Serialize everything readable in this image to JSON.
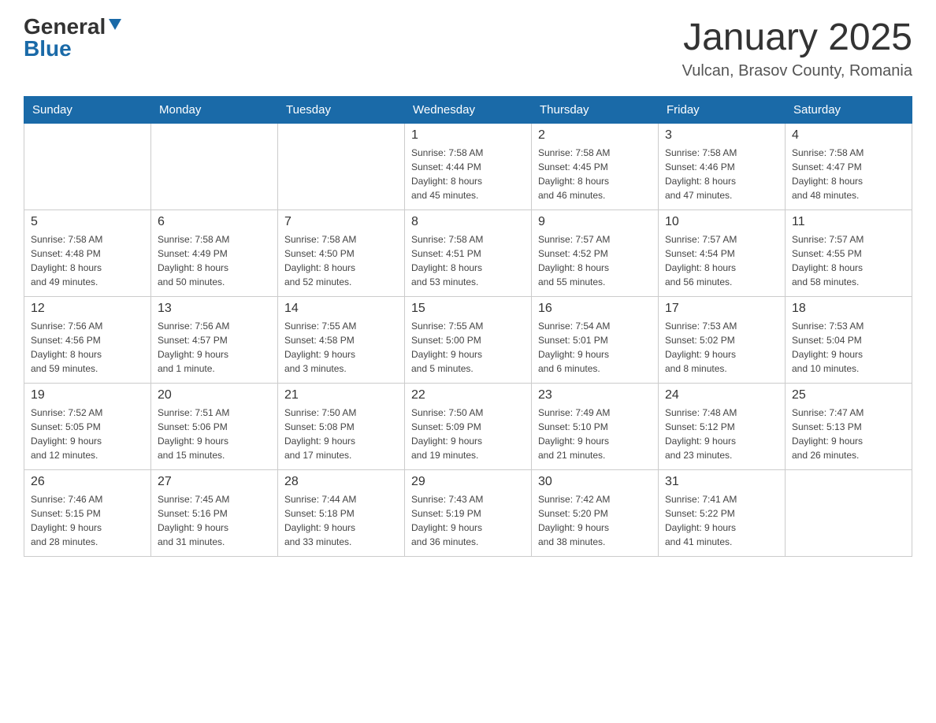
{
  "header": {
    "logo_general": "General",
    "logo_blue": "Blue",
    "month_title": "January 2025",
    "location": "Vulcan, Brasov County, Romania"
  },
  "days_of_week": [
    "Sunday",
    "Monday",
    "Tuesday",
    "Wednesday",
    "Thursday",
    "Friday",
    "Saturday"
  ],
  "weeks": [
    [
      {
        "day": "",
        "info": ""
      },
      {
        "day": "",
        "info": ""
      },
      {
        "day": "",
        "info": ""
      },
      {
        "day": "1",
        "info": "Sunrise: 7:58 AM\nSunset: 4:44 PM\nDaylight: 8 hours\nand 45 minutes."
      },
      {
        "day": "2",
        "info": "Sunrise: 7:58 AM\nSunset: 4:45 PM\nDaylight: 8 hours\nand 46 minutes."
      },
      {
        "day": "3",
        "info": "Sunrise: 7:58 AM\nSunset: 4:46 PM\nDaylight: 8 hours\nand 47 minutes."
      },
      {
        "day": "4",
        "info": "Sunrise: 7:58 AM\nSunset: 4:47 PM\nDaylight: 8 hours\nand 48 minutes."
      }
    ],
    [
      {
        "day": "5",
        "info": "Sunrise: 7:58 AM\nSunset: 4:48 PM\nDaylight: 8 hours\nand 49 minutes."
      },
      {
        "day": "6",
        "info": "Sunrise: 7:58 AM\nSunset: 4:49 PM\nDaylight: 8 hours\nand 50 minutes."
      },
      {
        "day": "7",
        "info": "Sunrise: 7:58 AM\nSunset: 4:50 PM\nDaylight: 8 hours\nand 52 minutes."
      },
      {
        "day": "8",
        "info": "Sunrise: 7:58 AM\nSunset: 4:51 PM\nDaylight: 8 hours\nand 53 minutes."
      },
      {
        "day": "9",
        "info": "Sunrise: 7:57 AM\nSunset: 4:52 PM\nDaylight: 8 hours\nand 55 minutes."
      },
      {
        "day": "10",
        "info": "Sunrise: 7:57 AM\nSunset: 4:54 PM\nDaylight: 8 hours\nand 56 minutes."
      },
      {
        "day": "11",
        "info": "Sunrise: 7:57 AM\nSunset: 4:55 PM\nDaylight: 8 hours\nand 58 minutes."
      }
    ],
    [
      {
        "day": "12",
        "info": "Sunrise: 7:56 AM\nSunset: 4:56 PM\nDaylight: 8 hours\nand 59 minutes."
      },
      {
        "day": "13",
        "info": "Sunrise: 7:56 AM\nSunset: 4:57 PM\nDaylight: 9 hours\nand 1 minute."
      },
      {
        "day": "14",
        "info": "Sunrise: 7:55 AM\nSunset: 4:58 PM\nDaylight: 9 hours\nand 3 minutes."
      },
      {
        "day": "15",
        "info": "Sunrise: 7:55 AM\nSunset: 5:00 PM\nDaylight: 9 hours\nand 5 minutes."
      },
      {
        "day": "16",
        "info": "Sunrise: 7:54 AM\nSunset: 5:01 PM\nDaylight: 9 hours\nand 6 minutes."
      },
      {
        "day": "17",
        "info": "Sunrise: 7:53 AM\nSunset: 5:02 PM\nDaylight: 9 hours\nand 8 minutes."
      },
      {
        "day": "18",
        "info": "Sunrise: 7:53 AM\nSunset: 5:04 PM\nDaylight: 9 hours\nand 10 minutes."
      }
    ],
    [
      {
        "day": "19",
        "info": "Sunrise: 7:52 AM\nSunset: 5:05 PM\nDaylight: 9 hours\nand 12 minutes."
      },
      {
        "day": "20",
        "info": "Sunrise: 7:51 AM\nSunset: 5:06 PM\nDaylight: 9 hours\nand 15 minutes."
      },
      {
        "day": "21",
        "info": "Sunrise: 7:50 AM\nSunset: 5:08 PM\nDaylight: 9 hours\nand 17 minutes."
      },
      {
        "day": "22",
        "info": "Sunrise: 7:50 AM\nSunset: 5:09 PM\nDaylight: 9 hours\nand 19 minutes."
      },
      {
        "day": "23",
        "info": "Sunrise: 7:49 AM\nSunset: 5:10 PM\nDaylight: 9 hours\nand 21 minutes."
      },
      {
        "day": "24",
        "info": "Sunrise: 7:48 AM\nSunset: 5:12 PM\nDaylight: 9 hours\nand 23 minutes."
      },
      {
        "day": "25",
        "info": "Sunrise: 7:47 AM\nSunset: 5:13 PM\nDaylight: 9 hours\nand 26 minutes."
      }
    ],
    [
      {
        "day": "26",
        "info": "Sunrise: 7:46 AM\nSunset: 5:15 PM\nDaylight: 9 hours\nand 28 minutes."
      },
      {
        "day": "27",
        "info": "Sunrise: 7:45 AM\nSunset: 5:16 PM\nDaylight: 9 hours\nand 31 minutes."
      },
      {
        "day": "28",
        "info": "Sunrise: 7:44 AM\nSunset: 5:18 PM\nDaylight: 9 hours\nand 33 minutes."
      },
      {
        "day": "29",
        "info": "Sunrise: 7:43 AM\nSunset: 5:19 PM\nDaylight: 9 hours\nand 36 minutes."
      },
      {
        "day": "30",
        "info": "Sunrise: 7:42 AM\nSunset: 5:20 PM\nDaylight: 9 hours\nand 38 minutes."
      },
      {
        "day": "31",
        "info": "Sunrise: 7:41 AM\nSunset: 5:22 PM\nDaylight: 9 hours\nand 41 minutes."
      },
      {
        "day": "",
        "info": ""
      }
    ]
  ]
}
